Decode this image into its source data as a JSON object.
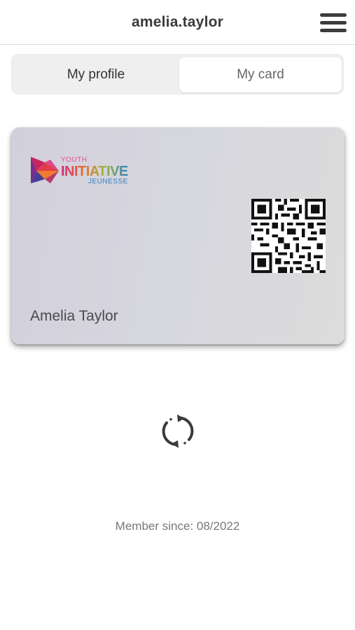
{
  "header": {
    "title": "amelia.taylor",
    "menu_icon": "hamburger-menu-icon"
  },
  "tabs": [
    {
      "label": "My profile",
      "selected": false
    },
    {
      "label": "My card",
      "selected": true
    }
  ],
  "card": {
    "logo": {
      "line1": "YOUTH",
      "line2": "INITIATIVE",
      "line3": "JEUNESSE"
    },
    "holder_name": "Amelia Taylor",
    "qr_icon": "qr-code"
  },
  "refresh_icon": "sync-icon",
  "member_since": "Member since: 08/2022",
  "colors": {
    "accent_pink": "#d6287a",
    "accent_blue": "#2d7fc1",
    "text_dark": "#3a3a3a"
  }
}
